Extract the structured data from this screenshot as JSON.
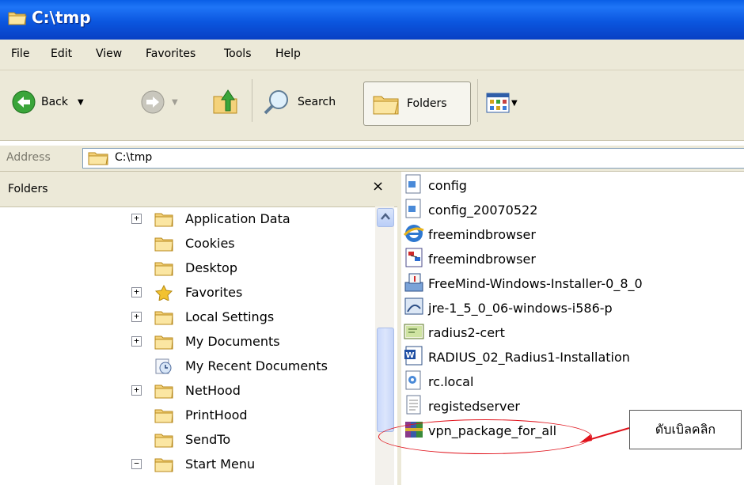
{
  "window": {
    "title": "C:\\tmp"
  },
  "menu": [
    "File",
    "Edit",
    "View",
    "Favorites",
    "Tools",
    "Help"
  ],
  "toolbar": {
    "back_label": "Back",
    "search_label": "Search",
    "folders_label": "Folders"
  },
  "address": {
    "label": "Address",
    "value": "C:\\tmp"
  },
  "folders_pane": {
    "title": "Folders",
    "close_glyph": "×",
    "items": [
      {
        "label": "Application Data",
        "expander": "+"
      },
      {
        "label": "Cookies",
        "expander": ""
      },
      {
        "label": "Desktop",
        "expander": ""
      },
      {
        "label": "Favorites",
        "expander": "+"
      },
      {
        "label": "Local Settings",
        "expander": "+"
      },
      {
        "label": "My Documents",
        "expander": "+"
      },
      {
        "label": "My Recent Documents",
        "expander": ""
      },
      {
        "label": "NetHood",
        "expander": "+"
      },
      {
        "label": "PrintHood",
        "expander": ""
      },
      {
        "label": "SendTo",
        "expander": ""
      },
      {
        "label": "Start Menu",
        "expander": "−"
      }
    ]
  },
  "files": [
    {
      "name": "config",
      "icon": "generic-file-icon"
    },
    {
      "name": "config_20070522",
      "icon": "generic-file-icon"
    },
    {
      "name": "freemindbrowser",
      "icon": "html-file-icon"
    },
    {
      "name": "freemindbrowser",
      "icon": "mindmap-file-icon"
    },
    {
      "name": "FreeMind-Windows-Installer-0_8_0",
      "icon": "installer-icon"
    },
    {
      "name": "jre-1_5_0_06-windows-i586-p",
      "icon": "java-installer-icon"
    },
    {
      "name": "radius2-cert",
      "icon": "certificate-icon"
    },
    {
      "name": "RADIUS_02_Radius1-Installation",
      "icon": "word-document-icon"
    },
    {
      "name": "rc.local",
      "icon": "script-file-icon"
    },
    {
      "name": "registedserver",
      "icon": "text-file-icon"
    },
    {
      "name": "vpn_package_for_all",
      "icon": "winrar-archive-icon"
    }
  ],
  "annotation": {
    "callout_text": "ดับเบิลคลิก"
  },
  "colors": {
    "titlebar": "#0b56df",
    "chrome": "#ece9d8",
    "annotation": "#e0121b"
  }
}
